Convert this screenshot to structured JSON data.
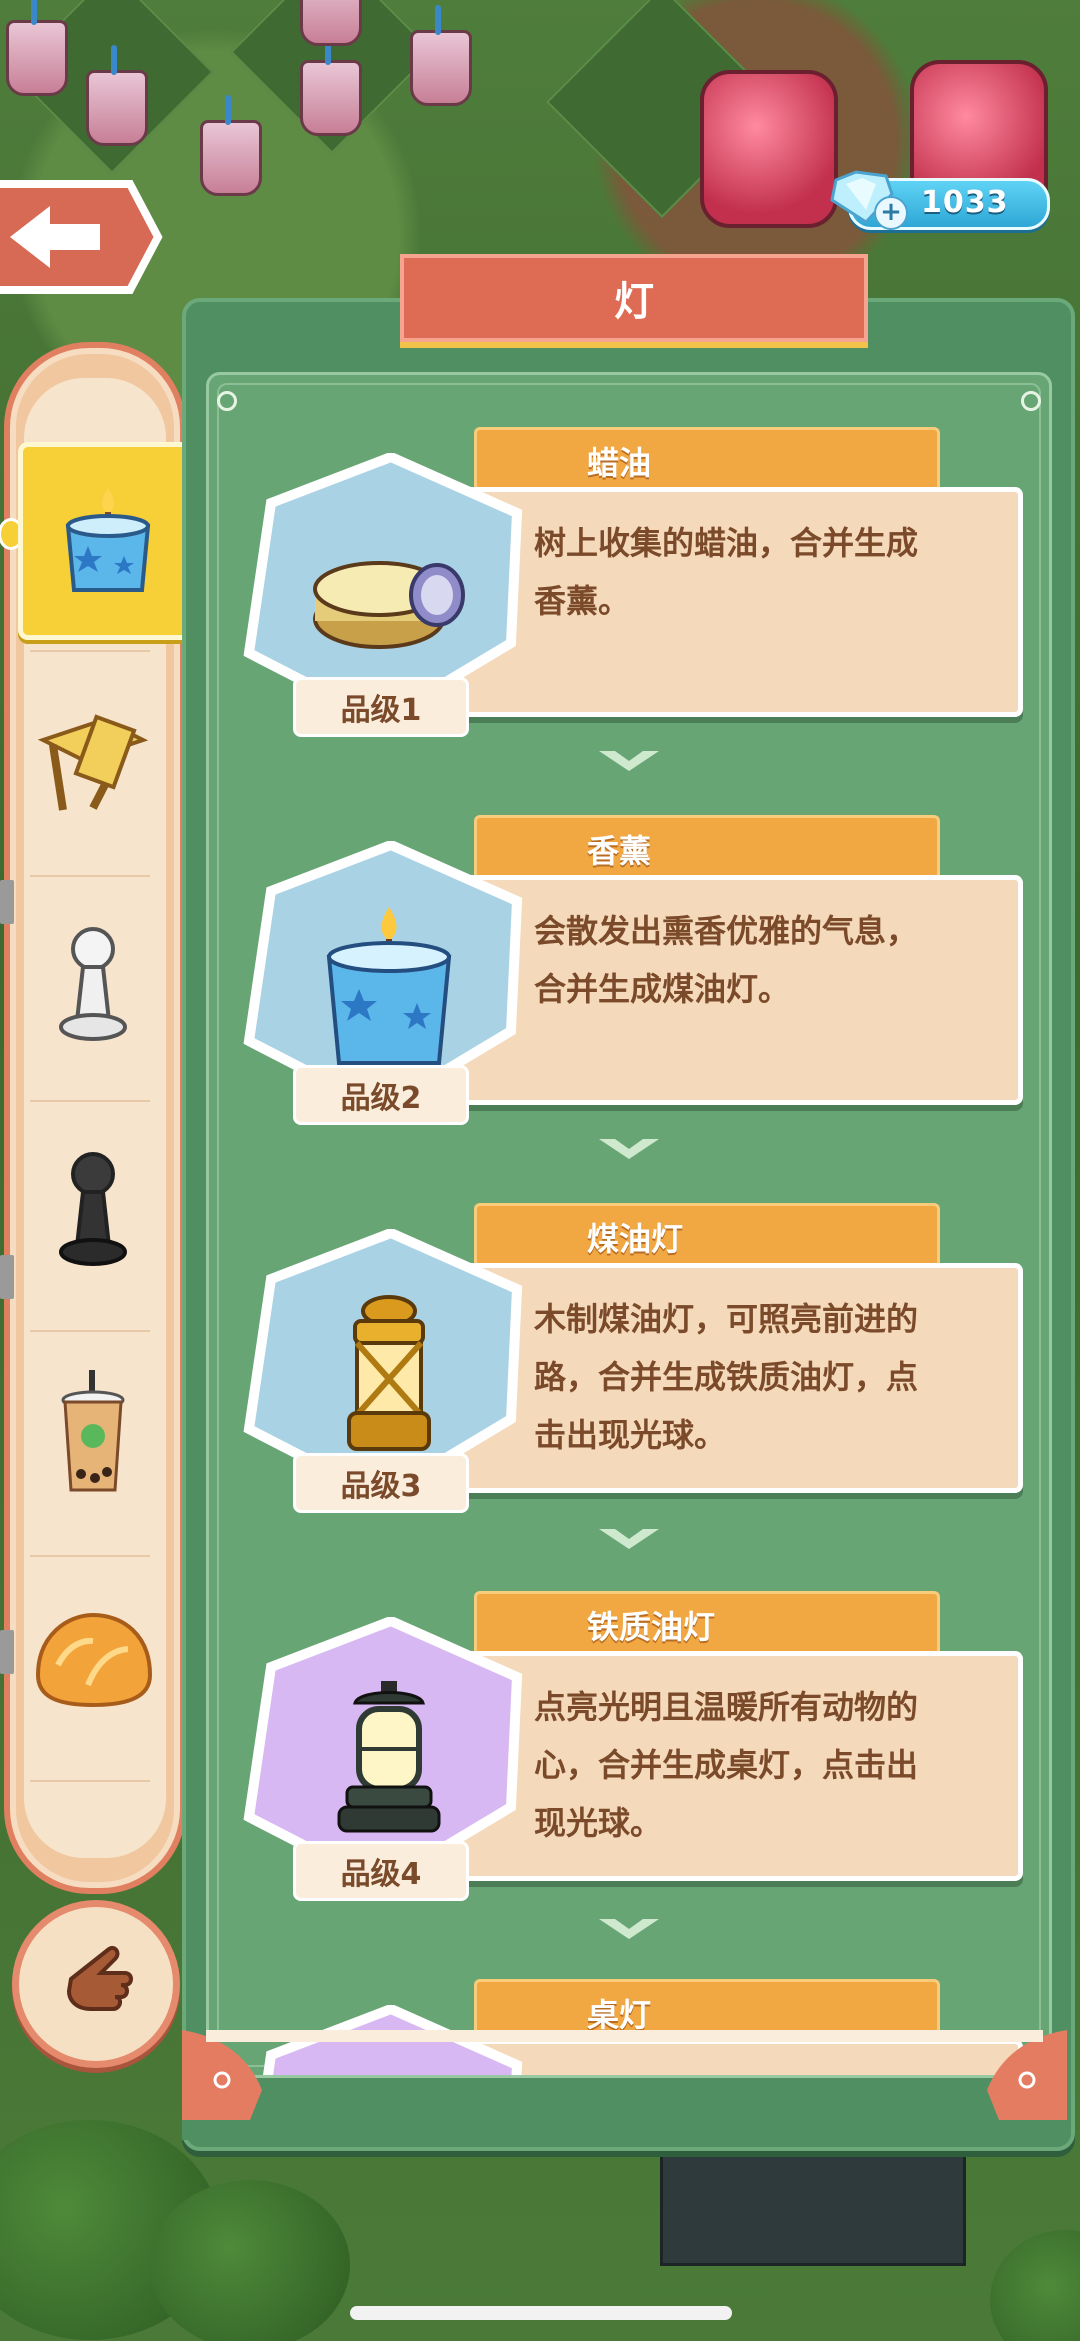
{
  "panel": {
    "title": "灯"
  },
  "currency": {
    "gems": "1033",
    "plus": "+"
  },
  "rail": {
    "items": [
      {
        "name": "candle-category",
        "selected": true
      },
      {
        "name": "chair-category",
        "selected": false
      },
      {
        "name": "white-pawn-category",
        "selected": false
      },
      {
        "name": "black-pawn-category",
        "selected": false
      },
      {
        "name": "bubble-tea-category",
        "selected": false
      },
      {
        "name": "bread-category",
        "selected": false
      }
    ]
  },
  "items": [
    {
      "name": "蜡油",
      "desc": "树上收集的蜡油，合并生成香薰。",
      "grade": "品级1",
      "bg": "#a9d2e4"
    },
    {
      "name": "香薰",
      "desc": "会散发出熏香优雅的气息，合并生成煤油灯。",
      "grade": "品级2",
      "bg": "#a9d2e4"
    },
    {
      "name": "煤油灯",
      "desc": "木制煤油灯，可照亮前进的路，合并生成铁质油灯，点击出现光球。",
      "grade": "品级3",
      "bg": "#a9d2e4"
    },
    {
      "name": "铁质油灯",
      "desc": "点亮光明且温暖所有动物的心，合并生成桌灯，点击出现光球。",
      "grade": "品级4",
      "bg": "#d8b8f2"
    },
    {
      "name": "桌灯",
      "desc": "",
      "grade": "",
      "bg": "#d8b8f2"
    }
  ],
  "colors": {
    "accent": "#de6b53",
    "panel": "#4f8f62",
    "gem": "#2ea7d6",
    "tab": "#f1a742"
  }
}
